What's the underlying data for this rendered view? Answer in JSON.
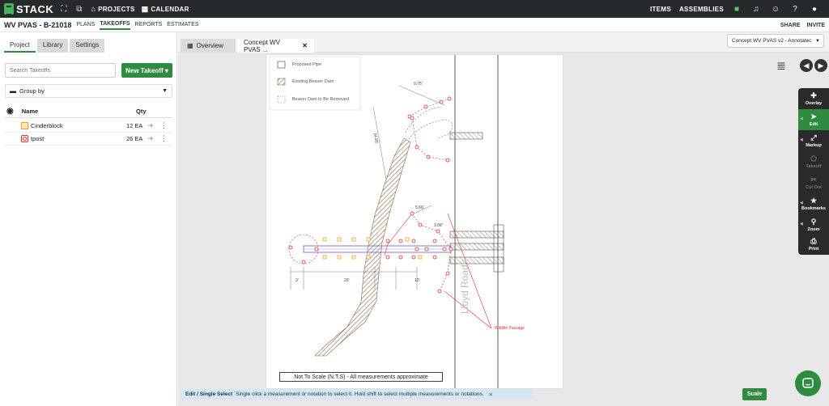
{
  "topbar": {
    "brand": "STACK",
    "projects_label": "PROJECTS",
    "calendar_label": "CALENDAR",
    "items_label": "ITEMS",
    "assemblies_label": "ASSEMBLIES"
  },
  "subbar": {
    "project_title": "WV PVAS - B-21018",
    "tabs": [
      "PLANS",
      "TAKEOFFS",
      "REPORTS",
      "ESTIMATES"
    ],
    "active_tab": "TAKEOFFS",
    "share_label": "SHARE",
    "invite_label": "INVITE"
  },
  "leftpanel": {
    "tabs": [
      "Project",
      "Library",
      "Settings"
    ],
    "search_placeholder": "Search Takeoffs",
    "new_takeoff_label": "New Takeoff ▾",
    "group_by_label": "Group by",
    "columns": {
      "name": "Name",
      "qty": "Qty"
    },
    "rows": [
      {
        "name": "Cinderblock",
        "qty": "12 EA",
        "color": "#f0a020"
      },
      {
        "name": "tpost",
        "qty": "26 EA",
        "color": "#e03030"
      }
    ]
  },
  "viewer": {
    "tabs": [
      "Overview",
      "Concept WV PVAS ..."
    ],
    "sheet_select": "Concept WV PVAS v2 - Annotatec",
    "legend": [
      "Proposed Pipe",
      "Existing Beaver Dam",
      "Beaver Dam to Be Removed"
    ],
    "road_label": "Lloyd Road",
    "wildlife_label": "Wildlife Passage",
    "dims": [
      "9.75'",
      "14.85'",
      "3'",
      "20'",
      "10'",
      "5.66'",
      "3.08'"
    ],
    "note": "Not To Scale (N.T.S) - All measurements approximate"
  },
  "tools": [
    {
      "label": "Overlay",
      "icon": "overlay-icon",
      "state": "normal"
    },
    {
      "label": "Edit",
      "icon": "cursor-icon",
      "state": "active"
    },
    {
      "label": "Markup",
      "icon": "markup-icon",
      "state": "normal"
    },
    {
      "label": "Takeoff",
      "icon": "takeoff-icon",
      "state": "disabled"
    },
    {
      "label": "Cut Out",
      "icon": "cutout-icon",
      "state": "disabled"
    },
    {
      "label": "Bookmarks",
      "icon": "star-icon",
      "state": "normal"
    },
    {
      "label": "Zoom",
      "icon": "zoom-icon",
      "state": "normal"
    },
    {
      "label": "Print",
      "icon": "print-icon",
      "state": "normal"
    }
  ],
  "status": {
    "mode": "Edit / Single Select",
    "message": "Single click a measurement or notation to select it. Hold shift to select multiple measurements or notations."
  },
  "scale_label": "Scale",
  "colors": {
    "brand_green": "#2e8b40",
    "topbar": "#262a2d",
    "markup_red": "#e03030",
    "cinderblock_orange": "#f0a020"
  }
}
